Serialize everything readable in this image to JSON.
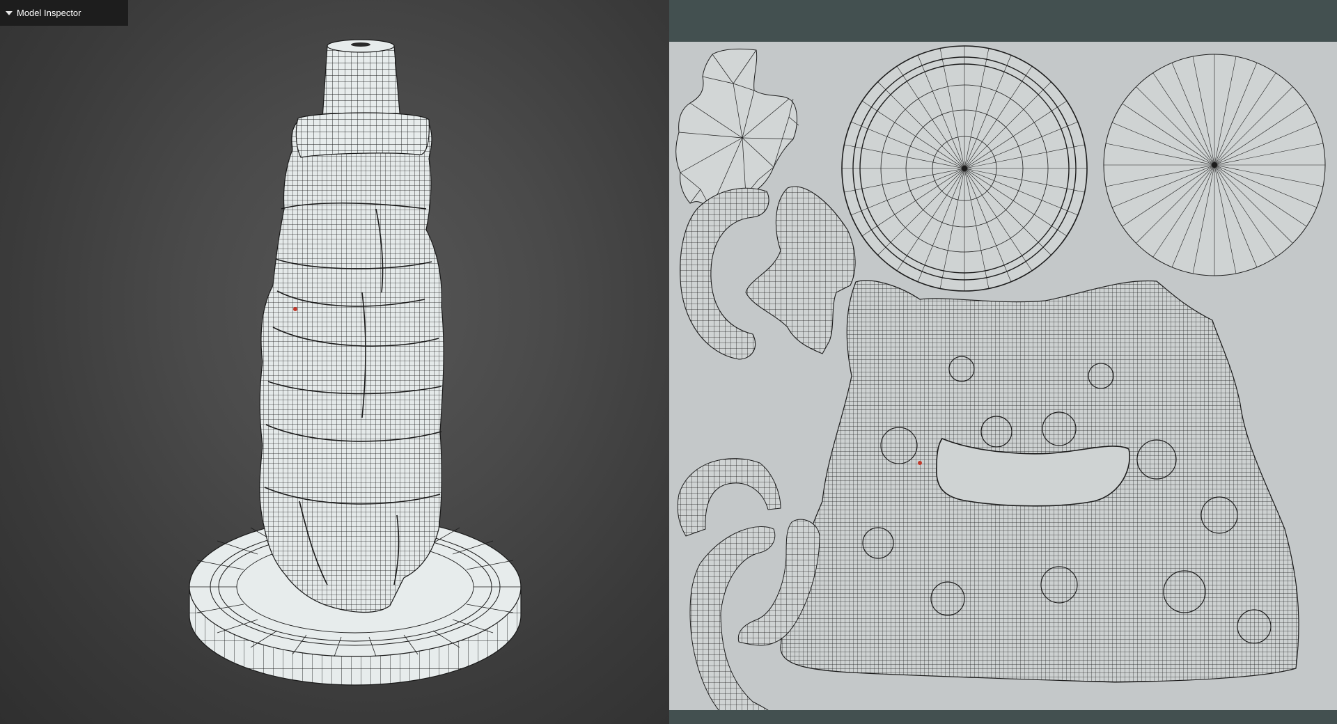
{
  "inspector": {
    "title": "Model Inspector",
    "caret_icon": "triangle-down-icon"
  },
  "viewport": {
    "background": "#4a4a4a",
    "mesh_fill": "#e7ecec",
    "wire_color": "#1a1a1a",
    "selection_color": "#c0392b"
  },
  "uv_editor": {
    "header_color": "#435050",
    "canvas_color": "#c4c8c9",
    "wire_color": "#1c1c1c",
    "islands": [
      "top-cap-island",
      "arm-island-a",
      "arm-island-b",
      "ring-disc-island",
      "solid-disc-island",
      "body-island",
      "strip-island-a",
      "strip-island-b",
      "strip-island-c"
    ]
  }
}
